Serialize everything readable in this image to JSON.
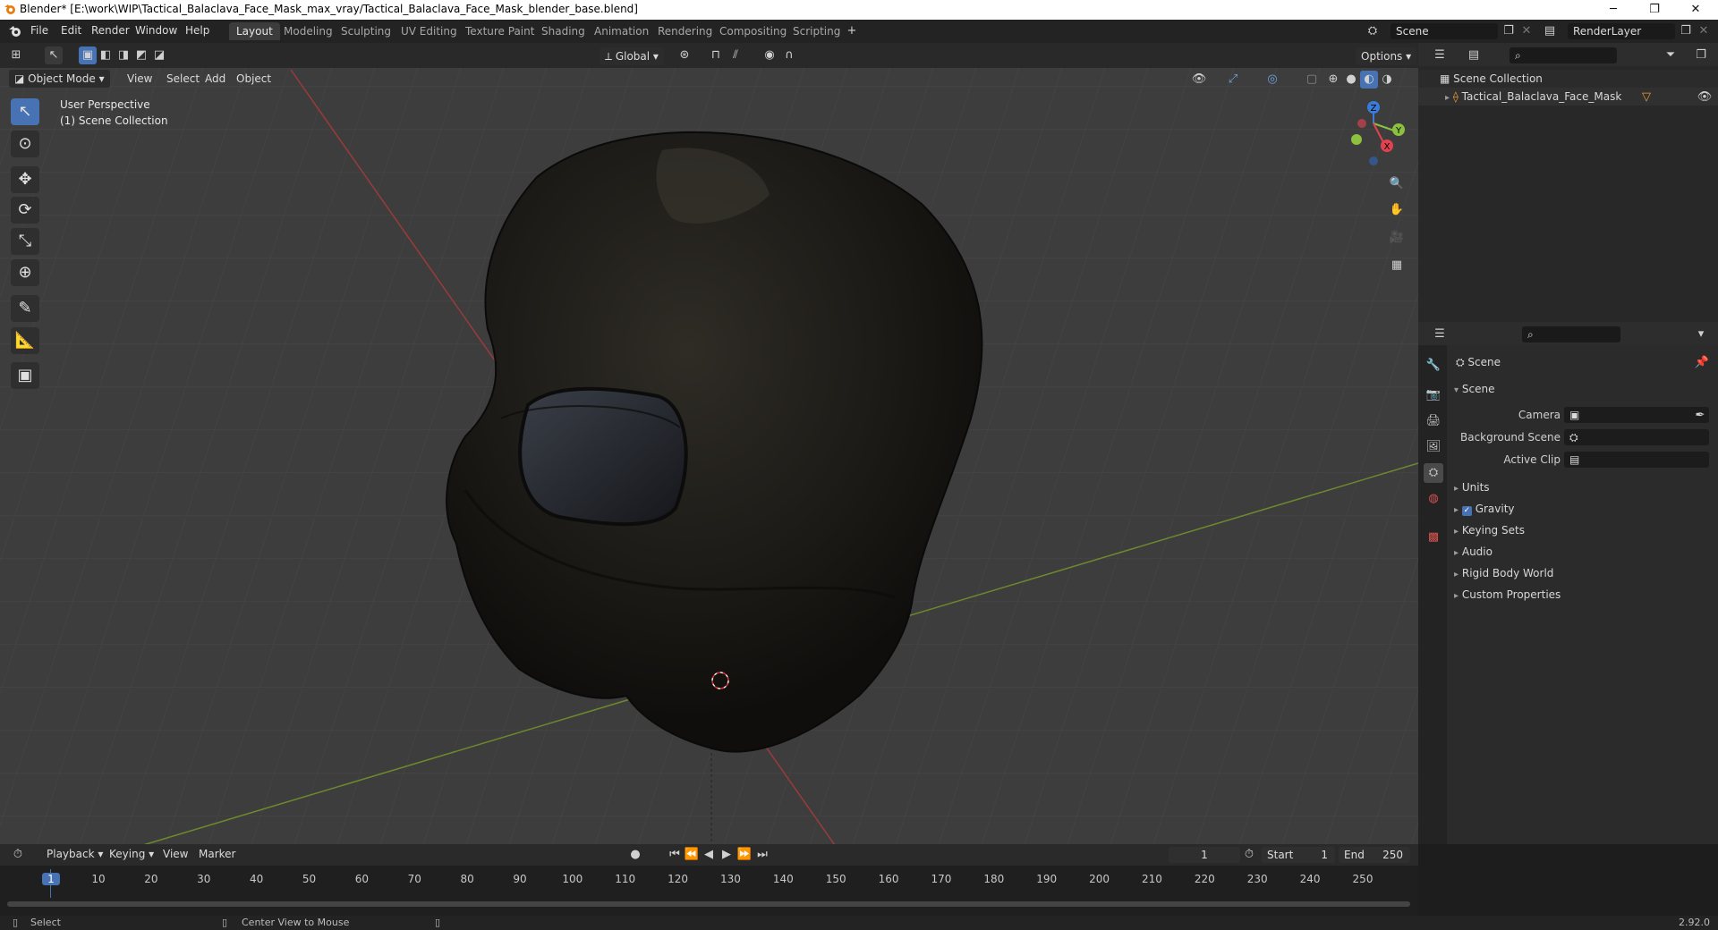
{
  "window": {
    "title": "Blender* [E:\\work\\WIP\\Tactical_Balaclava_Face_Mask_max_vray/Tactical_Balaclava_Face_Mask_blender_base.blend]",
    "minimize": "─",
    "maximize": "❐",
    "close": "✕"
  },
  "menu": [
    "File",
    "Edit",
    "Render",
    "Window",
    "Help"
  ],
  "workspaces": [
    "Layout",
    "Modeling",
    "Sculpting",
    "UV Editing",
    "Texture Paint",
    "Shading",
    "Animation",
    "Rendering",
    "Compositing",
    "Scripting"
  ],
  "active_workspace": "Layout",
  "scene_field": "Scene",
  "renderlayer_field": "RenderLayer",
  "viewport": {
    "mode": "Object Mode",
    "menus": [
      "View",
      "Select",
      "Add",
      "Object"
    ],
    "transform_orientation": "Global",
    "options": "Options",
    "overlay_line1": "User Perspective",
    "overlay_line2": "(1) Scene Collection",
    "gizmo_axes": {
      "x": "X",
      "y": "Y",
      "z": "Z"
    }
  },
  "outliner": {
    "root": "Scene Collection",
    "items": [
      "Tactical_Balaclava_Face_Mask"
    ]
  },
  "properties": {
    "header": "Scene",
    "panel": "Scene",
    "fields": [
      {
        "label": "Camera"
      },
      {
        "label": "Background Scene"
      },
      {
        "label": "Active Clip"
      }
    ],
    "subpanels": [
      "Units",
      "Gravity",
      "Keying Sets",
      "Audio",
      "Rigid Body World",
      "Custom Properties"
    ],
    "gravity_checked": true
  },
  "timeline": {
    "menus": [
      "Playback",
      "Keying",
      "View",
      "Marker"
    ],
    "current_frame": "1",
    "start_label": "Start",
    "start": "1",
    "end_label": "End",
    "end": "250",
    "ruler": [
      "1",
      "10",
      "20",
      "30",
      "40",
      "50",
      "60",
      "70",
      "80",
      "90",
      "100",
      "110",
      "120",
      "130",
      "140",
      "150",
      "160",
      "170",
      "180",
      "190",
      "200",
      "210",
      "220",
      "230",
      "240",
      "250"
    ]
  },
  "statusbar": {
    "left": "Select",
    "middle": "Center View to Mouse",
    "version": "2.92.0"
  }
}
